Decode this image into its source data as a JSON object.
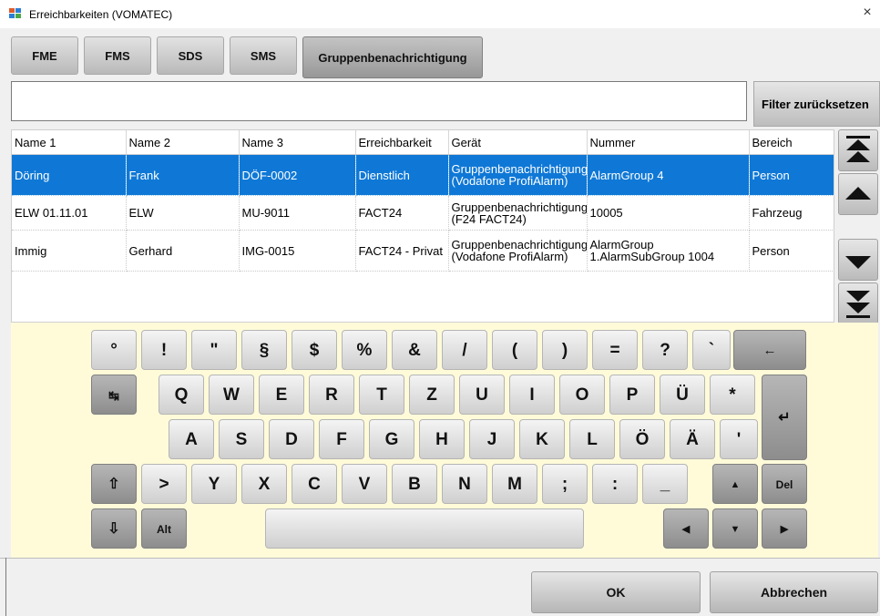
{
  "window": {
    "title": "Erreichbarkeiten (VOMATEC)",
    "close_symbol": "×"
  },
  "tabs": [
    {
      "label": "FME"
    },
    {
      "label": "FMS"
    },
    {
      "label": "SDS"
    },
    {
      "label": "SMS"
    },
    {
      "label": "Gruppenbenachrichtigung",
      "active": true
    }
  ],
  "filter": {
    "value": "",
    "placeholder": "",
    "reset_label": "Filter zurücksetzen"
  },
  "table": {
    "columns": [
      "Name 1",
      "Name 2",
      "Name 3",
      "Erreichbarkeit",
      "Gerät",
      "Nummer",
      "Bereich"
    ],
    "rows": [
      {
        "cells": [
          "Döring",
          "Frank",
          "DÖF-0002",
          "Dienstlich",
          "Gruppenbenachrichtigung (Vodafone ProfiAlarm)",
          "AlarmGroup 4",
          "Person"
        ],
        "selected": true
      },
      {
        "cells": [
          "ELW 01.11.01",
          "ELW",
          "MU-9011",
          "FACT24",
          "Gruppenbenachrichtigung (F24 FACT24)",
          "10005",
          "Fahrzeug"
        ],
        "selected": false
      },
      {
        "cells": [
          "Immig",
          "Gerhard",
          "IMG-0015",
          "FACT24 - Privat",
          "Gruppenbenachrichtigung (Vodafone ProfiAlarm)",
          "AlarmGroup 1.AlarmSubGroup 1004",
          "Person"
        ],
        "selected": false
      }
    ]
  },
  "keyboard": {
    "row1": [
      "°",
      "!",
      "\"",
      "§",
      "$",
      "%",
      "&",
      "/",
      "(",
      ")",
      "=",
      "?",
      "`",
      "←"
    ],
    "row2": [
      "↹",
      "Q",
      "W",
      "E",
      "R",
      "T",
      "Z",
      "U",
      "I",
      "O",
      "P",
      "Ü",
      "*"
    ],
    "enter": "↵",
    "row3": [
      "A",
      "S",
      "D",
      "F",
      "G",
      "H",
      "J",
      "K",
      "L",
      "Ö",
      "Ä",
      "'"
    ],
    "row4": [
      "⇧",
      ">",
      "Y",
      "X",
      "C",
      "V",
      "B",
      "N",
      "M",
      ";",
      ":",
      "_",
      "▲",
      "Del"
    ],
    "row5": {
      "shift_lock": "⇩",
      "alt": "Alt",
      "space": "",
      "left": "◀",
      "down": "▼",
      "right": "▶"
    }
  },
  "buttons": {
    "ok": "OK",
    "cancel": "Abbrechen"
  },
  "colors": {
    "selection": "#0f78d6",
    "keyboard_bg": "#fffbd9"
  },
  "icons": {
    "app": "app-window-icon",
    "scroll_top": "double-up-arrow-icon",
    "scroll_up": "up-arrow-icon",
    "scroll_down": "down-arrow-icon",
    "scroll_bottom": "double-down-arrow-icon"
  }
}
